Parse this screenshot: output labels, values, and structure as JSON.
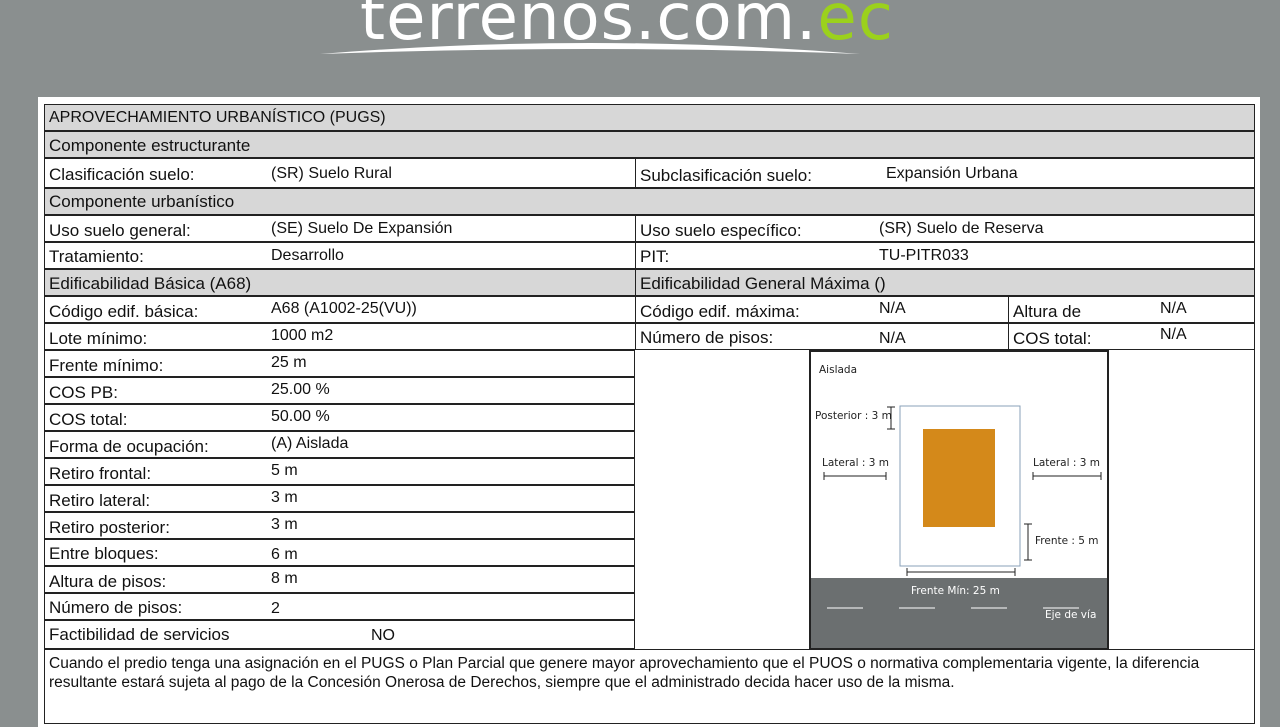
{
  "logo": {
    "text_main": "terrenos.com.",
    "text_accent": "ec"
  },
  "title": "APROVECHAMIENTO URBANÍSTICO (PUGS)",
  "sections": {
    "estructurante": "Componente  estructurante",
    "urbanistico": "Componente  urbanístico",
    "edif_basica": "Edificabilidad Básica (A68)",
    "edif_max": "Edificabilidad General Máxima ()"
  },
  "fields": {
    "clasificacion": {
      "label": "Clasificación suelo:",
      "value": "(SR) Suelo Rural"
    },
    "subclasificacion": {
      "label": "Subclasificación suelo:",
      "value": "Expansión Urbana"
    },
    "uso_general": {
      "label": "Uso suelo general:",
      "value": "(SE) Suelo De Expansión"
    },
    "uso_especifico": {
      "label": "Uso suelo específico:",
      "value": "(SR) Suelo de Reserva"
    },
    "tratamiento": {
      "label": "Tratamiento:",
      "value": "Desarrollo"
    },
    "pit": {
      "label": "PIT:",
      "value": "TU-PITR033"
    },
    "codigo_basica": {
      "label": "Código edif. básica:",
      "value": "A68 (A1002-25(VU))"
    },
    "codigo_maxima": {
      "label": "Código edif. máxima:",
      "value": "N/A"
    },
    "altura_de": {
      "label": "Altura de",
      "value": "N/A"
    },
    "lote_minimo": {
      "label": "Lote mínimo:",
      "value": "1000 m2"
    },
    "numero_pisos_max": {
      "label": "Número de pisos:",
      "value": "N/A"
    },
    "cos_total_max": {
      "label": "COS total:",
      "value": "N/A"
    },
    "frente_minimo": {
      "label": "Frente mínimo:",
      "value": "25 m"
    },
    "cos_pb": {
      "label": "COS PB:",
      "value": "25.00 %"
    },
    "cos_total": {
      "label": "COS total:",
      "value": "50.00 %"
    },
    "forma_ocupacion": {
      "label": "Forma de ocupación:",
      "value": "(A) Aislada"
    },
    "retiro_frontal": {
      "label": "Retiro frontal:",
      "value": "5 m"
    },
    "retiro_lateral": {
      "label": "Retiro lateral:",
      "value": "3 m"
    },
    "retiro_posterior": {
      "label": "Retiro posterior:",
      "value": "3 m"
    },
    "entre_bloques": {
      "label": "Entre bloques:",
      "value": "6 m"
    },
    "altura_pisos": {
      "label": "Altura de pisos:",
      "value": "8 m"
    },
    "numero_pisos": {
      "label": "Número de pisos:",
      "value": "2"
    },
    "factibilidad": {
      "label": "Factibilidad de servicios",
      "value": "NO"
    }
  },
  "diagram": {
    "tipo": "Aislada",
    "posterior": "Posterior : 3 m",
    "lateral_left": "Lateral : 3 m",
    "lateral_right": "Lateral : 3 m",
    "frente": "Frente : 5 m",
    "frente_min": "Frente Mín: 25 m",
    "eje": "Eje de vía",
    "building_color": "#d4891a",
    "road_color": "#6b6f70"
  },
  "note": "Cuando el predio tenga una asignación en el PUGS o Plan Parcial que genere mayor aprovechamiento que el PUOS o normativa complementaria vigente, la diferencia resultante estará sujeta al pago de la Concesión Onerosa de Derechos, siempre que el administrado decida hacer uso de la misma."
}
